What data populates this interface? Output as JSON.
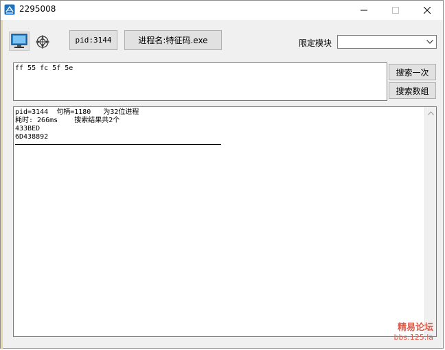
{
  "window": {
    "title": "2295008",
    "controls": {
      "minimize": "—",
      "maximize": "☐",
      "close": "✕"
    }
  },
  "toolbar": {
    "monitor_icon": "monitor-icon",
    "target_icon": "crosshair-target-icon",
    "pid_label": "pid:3144",
    "process_label": "进程名:特征码.exe"
  },
  "module_filter": {
    "label": "限定模块",
    "selected": ""
  },
  "search": {
    "pattern": "ff 55 fc 5f 5e",
    "search_once_label": "搜索一次",
    "search_array_label": "搜索数组"
  },
  "output": {
    "lines": [
      "pid=3144  句柄=1180   为32位进程",
      "耗时: 266ms    搜索结果共2个",
      "433BED",
      "6D438892"
    ]
  },
  "watermark": {
    "name": "精易论坛",
    "url": "bbs.125.la"
  },
  "colors": {
    "accent": "#1e73be",
    "watermark": "#e05a4a",
    "window_bg": "#f0f0f0"
  }
}
